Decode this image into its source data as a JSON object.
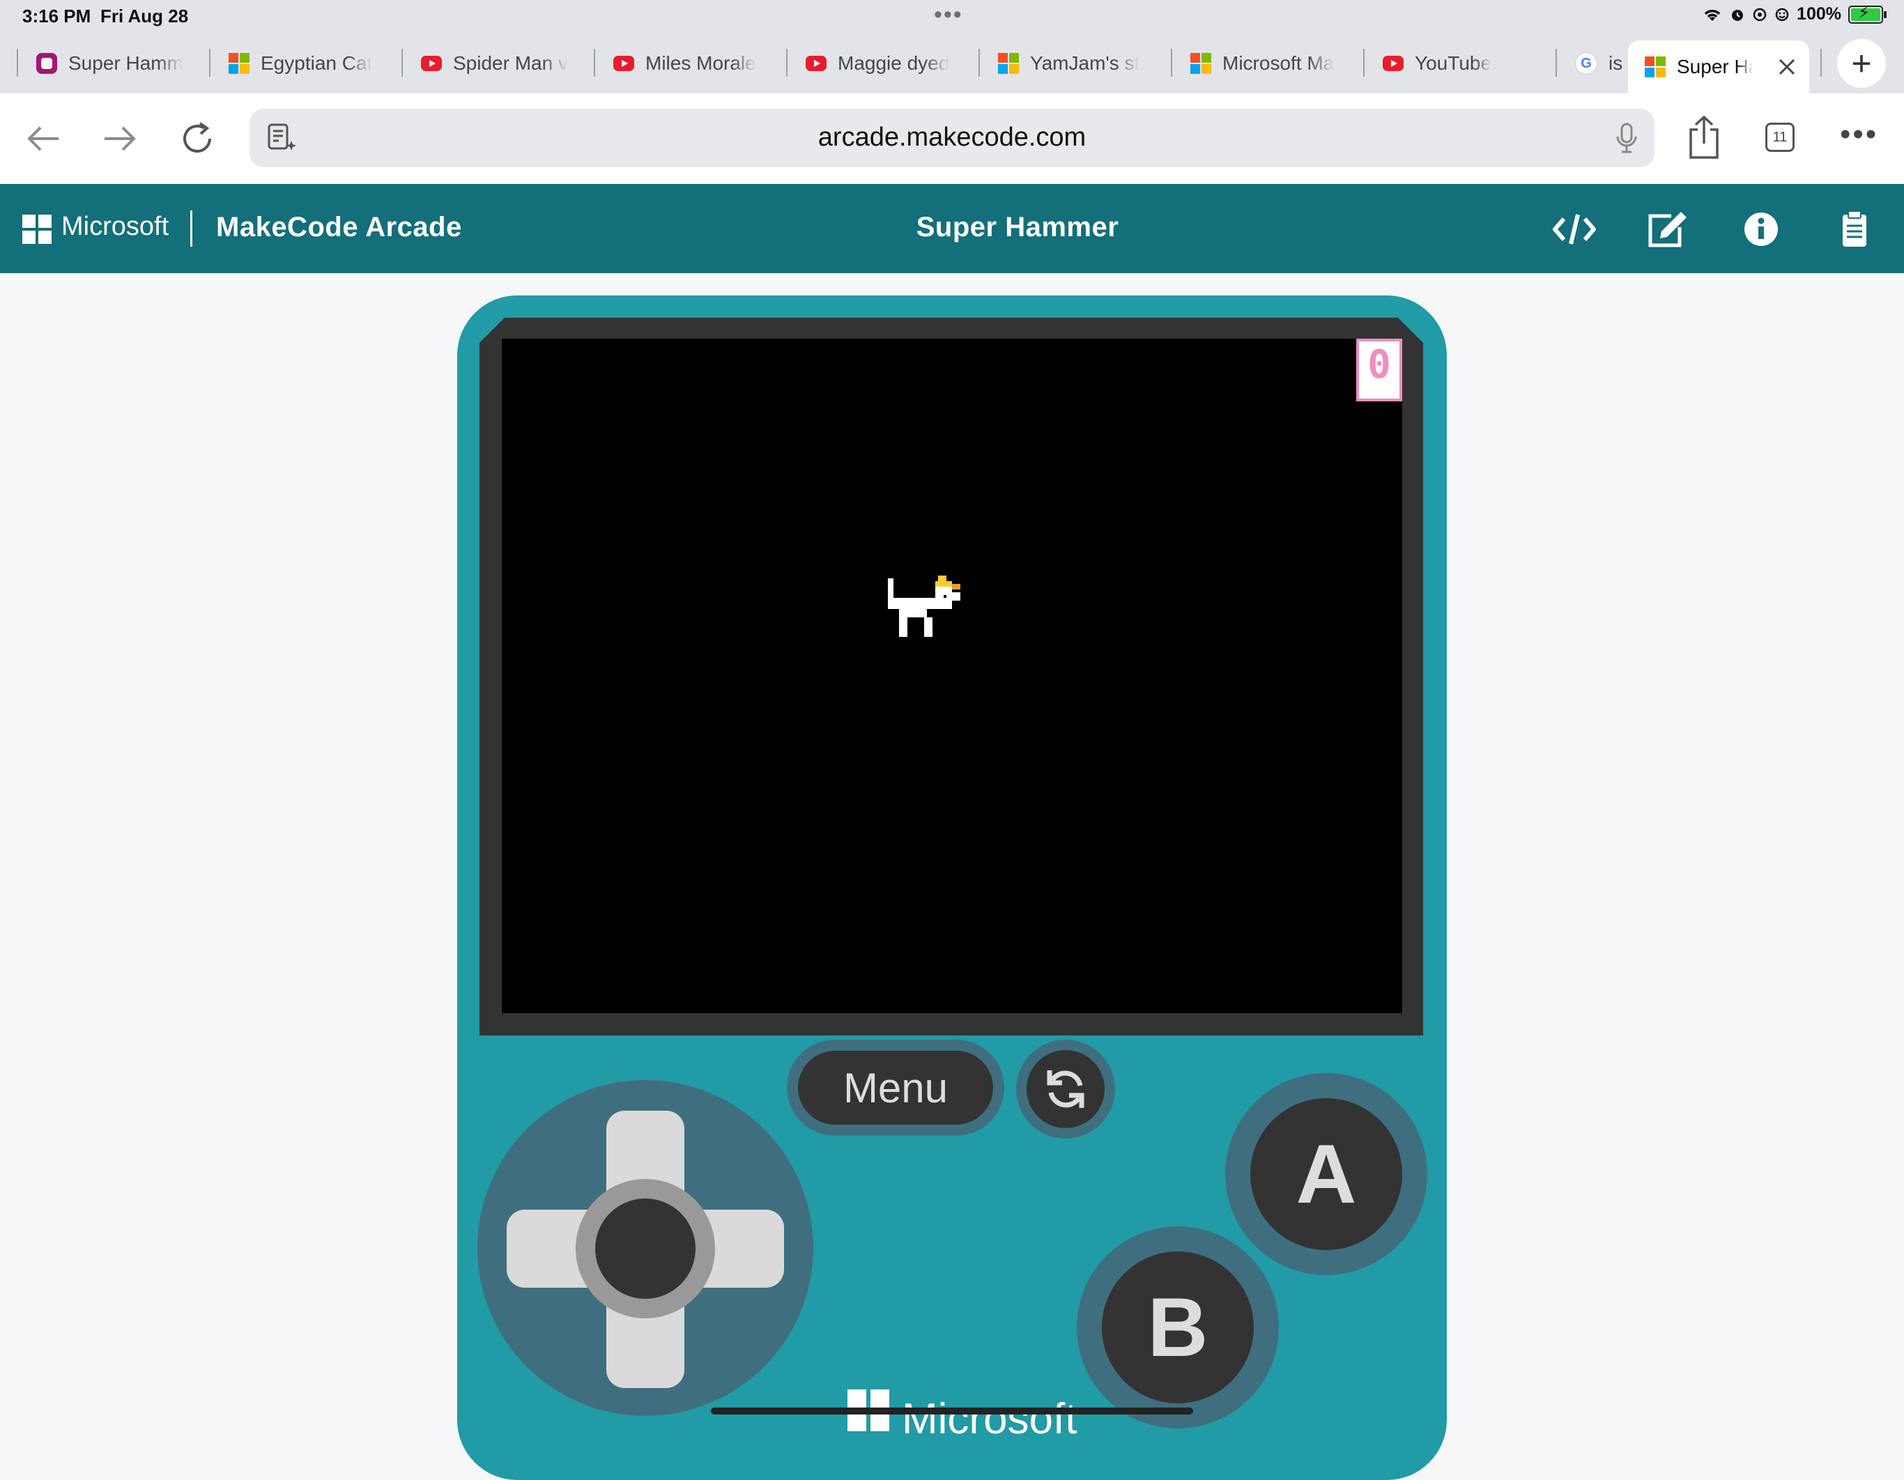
{
  "status_bar": {
    "time": "3:16 PM",
    "date": "Fri Aug 28",
    "battery": "100%",
    "battery_level": 1.0
  },
  "tabs": [
    {
      "label": "Super Hamm",
      "icon": "makecode-icon"
    },
    {
      "label": "Egyptian Cat",
      "icon": "microsoft-icon"
    },
    {
      "label": "Spider Man v",
      "icon": "youtube-icon"
    },
    {
      "label": "Miles Morale",
      "icon": "youtube-icon"
    },
    {
      "label": "Maggie dyed",
      "icon": "youtube-icon"
    },
    {
      "label": "YamJam's st",
      "icon": "microsoft-icon"
    },
    {
      "label": "Microsoft Ma",
      "icon": "microsoft-icon"
    },
    {
      "label": "YouTube",
      "icon": "youtube-icon"
    },
    {
      "label": "is",
      "icon": "google-icon"
    }
  ],
  "active_tab": {
    "label": "Super Ha",
    "icon": "microsoft-icon"
  },
  "address_bar": {
    "url": "arcade.makecode.com",
    "tab_count": "11"
  },
  "makecode": {
    "brand": "Microsoft",
    "app_name": "MakeCode Arcade",
    "project_name": "Super Hammer"
  },
  "game": {
    "score": "0",
    "menu_label": "Menu",
    "a_label": "A",
    "b_label": "B",
    "console_brand": "Microsoft"
  },
  "colors": {
    "header": "#136f79",
    "console": "#219ba5",
    "console_dark": "#3f6f7e",
    "score": "#ef8ec0"
  }
}
